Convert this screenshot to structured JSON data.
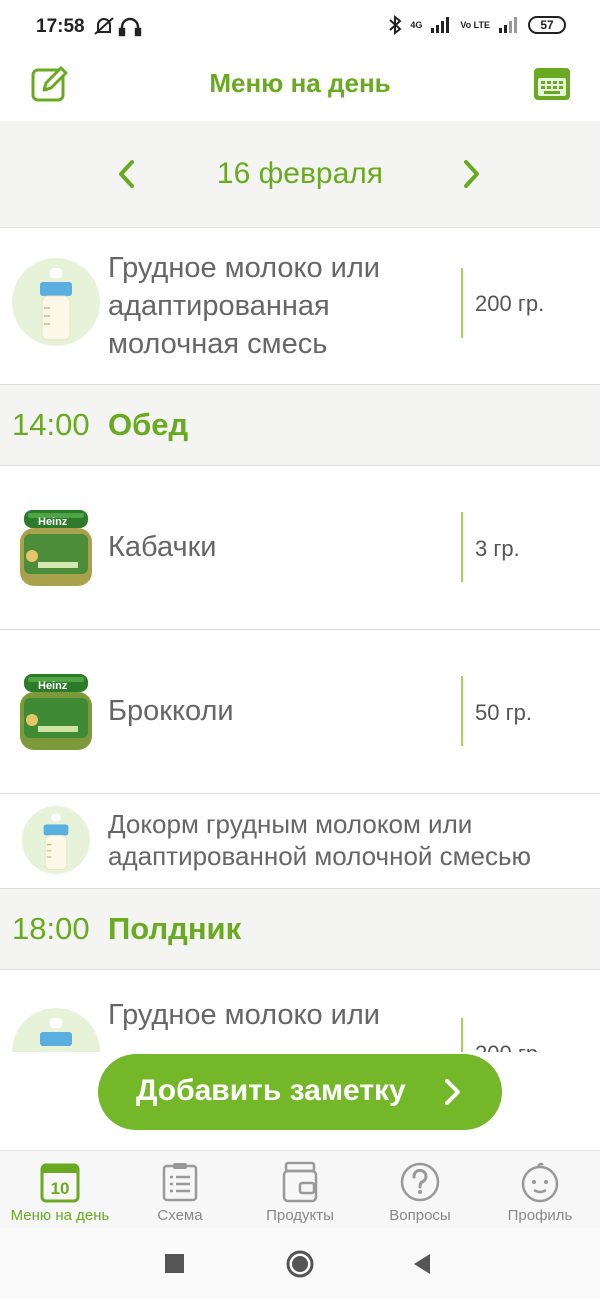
{
  "status": {
    "time": "17:58",
    "battery": "57",
    "net1": "4G",
    "net2": "Vo LTE"
  },
  "header": {
    "title": "Меню на день"
  },
  "date": {
    "label": "16 февраля"
  },
  "items": [
    {
      "name": "Грудное молоко или адаптированная молочная смесь",
      "amount": "200 гр.",
      "icon": "baby-bottle-icon"
    },
    {
      "name": "Кабачки",
      "amount": "3 гр.",
      "icon": "baby-food-jar-icon"
    },
    {
      "name": "Брокколи",
      "amount": "50 гр.",
      "icon": "baby-food-jar-icon"
    },
    {
      "name": "Докорм грудным молоком или адаптированной молочной смесью",
      "icon": "baby-bottle-icon"
    },
    {
      "name": "Грудное молоко или",
      "amount": "200 гр.",
      "icon": "baby-bottle-icon"
    }
  ],
  "meals": [
    {
      "time": "14:00",
      "name": "Обед"
    },
    {
      "time": "18:00",
      "name": "Полдник"
    }
  ],
  "jar_brand": "Heinz",
  "add_note": {
    "label": "Добавить заметку"
  },
  "tabs": [
    {
      "label": "Меню на день",
      "icon": "calendar-icon",
      "day": "10",
      "active": true
    },
    {
      "label": "Схема",
      "icon": "clipboard-list-icon"
    },
    {
      "label": "Продукты",
      "icon": "products-icon"
    },
    {
      "label": "Вопросы",
      "icon": "question-icon"
    },
    {
      "label": "Профиль",
      "icon": "baby-face-icon"
    }
  ],
  "colors": {
    "accent": "#6aaa22",
    "button": "#74b82a",
    "bar_bg": "#f4f4f2"
  }
}
